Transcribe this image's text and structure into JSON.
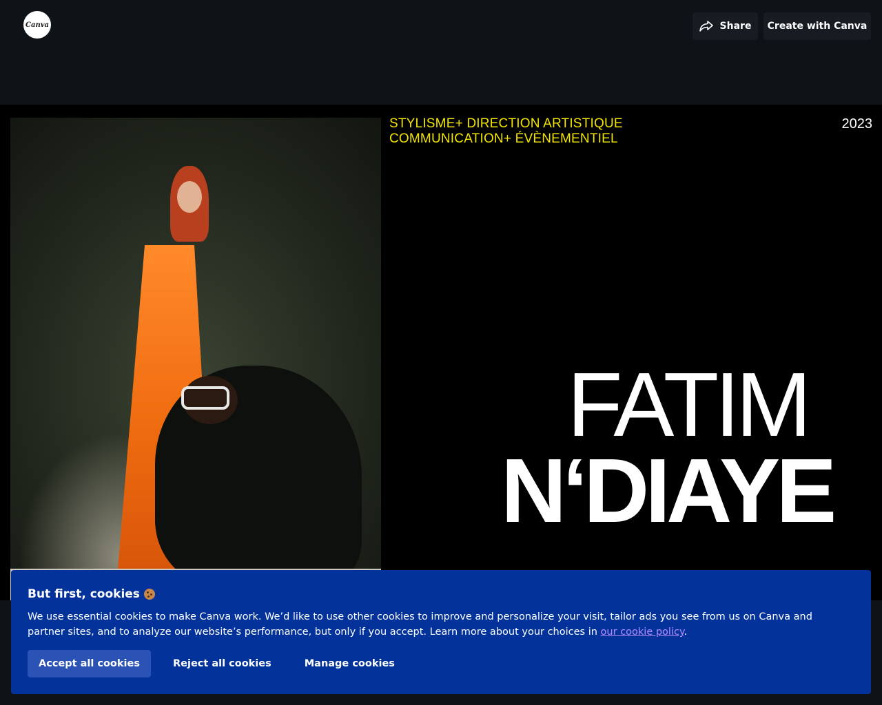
{
  "header": {
    "logo_text": "Canva",
    "share_label": "Share",
    "create_label": "Create with Canva"
  },
  "slide": {
    "services_line1": "STYLISME+ DIRECTION ARTISTIQUE",
    "services_line2": "COMMUNICATION+ ÉVÈNEMENTIEL",
    "year": "2023",
    "name_first": "FATIM",
    "name_last": "N‘DIAYE",
    "accent_color": "#f2e600"
  },
  "cookie_banner": {
    "title": "But first, cookies",
    "body": "We use essential cookies to make Canva work. We’d like to use other cookies to improve and personalize your visit, tailor ads you see from us on Canva and partner sites, and to analyze our website’s performance, but only if you accept. Learn more about your choices in ",
    "link_text": "our cookie policy",
    "body_end": ".",
    "accept_label": "Accept all cookies",
    "reject_label": "Reject all cookies",
    "manage_label": "Manage cookies",
    "background_color": "#03339a"
  }
}
